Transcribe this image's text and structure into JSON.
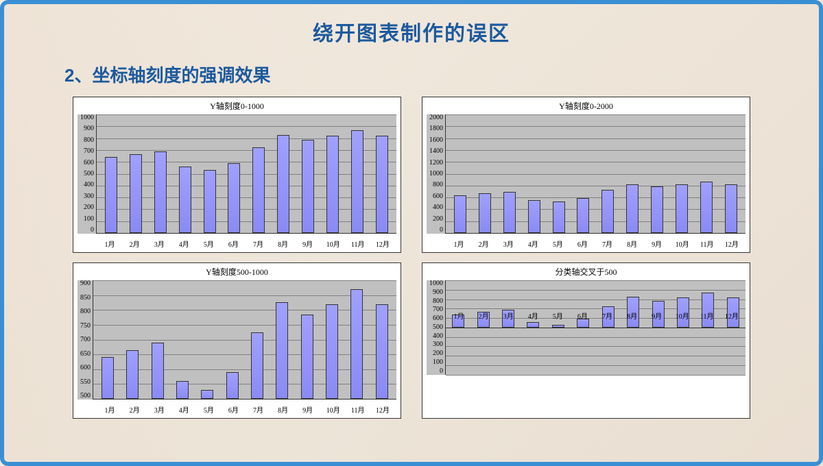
{
  "main_title": "绕开图表制作的误区",
  "sub_title": "2、坐标轴刻度的强调效果",
  "chart_data": [
    {
      "type": "bar",
      "title": "Y轴刻度0-1000",
      "categories": [
        "1月",
        "2月",
        "3月",
        "4月",
        "5月",
        "6月",
        "7月",
        "8月",
        "9月",
        "10月",
        "11月",
        "12月"
      ],
      "values": [
        640,
        665,
        690,
        560,
        530,
        590,
        725,
        825,
        785,
        820,
        870,
        820
      ],
      "ylim": [
        0,
        1000
      ],
      "ystep": 100,
      "xlabel": "",
      "ylabel": ""
    },
    {
      "type": "bar",
      "title": "Y轴刻度0-2000",
      "categories": [
        "1月",
        "2月",
        "3月",
        "4月",
        "5月",
        "6月",
        "7月",
        "8月",
        "9月",
        "10月",
        "11月",
        "12月"
      ],
      "values": [
        640,
        665,
        690,
        560,
        530,
        590,
        725,
        825,
        785,
        820,
        870,
        820
      ],
      "ylim": [
        0,
        2000
      ],
      "ystep": 200,
      "xlabel": "",
      "ylabel": ""
    },
    {
      "type": "bar",
      "title": "Y轴刻度500-1000",
      "categories": [
        "1月",
        "2月",
        "3月",
        "4月",
        "5月",
        "6月",
        "7月",
        "8月",
        "9月",
        "10月",
        "11月",
        "12月"
      ],
      "values": [
        640,
        665,
        690,
        560,
        530,
        590,
        725,
        825,
        785,
        820,
        870,
        820
      ],
      "ylim": [
        500,
        900
      ],
      "ystep": 50,
      "xlabel": "",
      "ylabel": ""
    },
    {
      "type": "bar",
      "title": "分类轴交叉于500",
      "categories": [
        "1月",
        "2月",
        "3月",
        "4月",
        "5月",
        "6月",
        "7月",
        "8月",
        "9月",
        "10月",
        "11月",
        "12月"
      ],
      "values": [
        640,
        665,
        690,
        560,
        530,
        590,
        725,
        825,
        785,
        820,
        870,
        820
      ],
      "ylim": [
        0,
        1000
      ],
      "ystep": 100,
      "baseline": 500,
      "xlabel": "",
      "ylabel": ""
    }
  ]
}
